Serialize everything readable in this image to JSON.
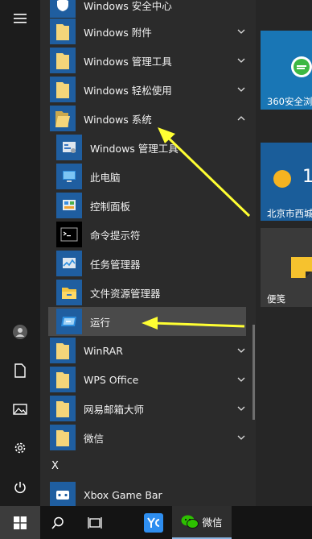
{
  "rail": {
    "items": [
      {
        "name": "hamburger-menu-icon"
      },
      {
        "name": "user-icon"
      },
      {
        "name": "document-icon"
      },
      {
        "name": "pictures-icon"
      },
      {
        "name": "settings-icon"
      },
      {
        "name": "power-icon"
      }
    ]
  },
  "app_list": {
    "top_partial": "Windows 安全中心",
    "folders_top": [
      {
        "label": "Windows 附件",
        "state": "collapsed"
      },
      {
        "label": "Windows 管理工具",
        "state": "collapsed"
      },
      {
        "label": "Windows 轻松使用",
        "state": "collapsed"
      },
      {
        "label": "Windows 系统",
        "state": "expanded"
      }
    ],
    "system_items": [
      {
        "label": "Windows 管理工具",
        "icon": "admin-tools-icon"
      },
      {
        "label": "此电脑",
        "icon": "this-pc-icon"
      },
      {
        "label": "控制面板",
        "icon": "control-panel-icon"
      },
      {
        "label": "命令提示符",
        "icon": "command-prompt-icon"
      },
      {
        "label": "任务管理器",
        "icon": "task-manager-icon"
      },
      {
        "label": "文件资源管理器",
        "icon": "file-explorer-icon"
      },
      {
        "label": "运行",
        "icon": "run-icon",
        "selected": true
      }
    ],
    "folders_bottom": [
      {
        "label": "WinRAR",
        "state": "collapsed"
      },
      {
        "label": "WPS Office",
        "state": "collapsed"
      },
      {
        "label": "网易邮箱大师",
        "state": "collapsed"
      },
      {
        "label": "微信",
        "state": "collapsed"
      }
    ],
    "section_letter": "X",
    "xbox_item": {
      "label": "Xbox Game Bar",
      "icon": "xbox-icon"
    }
  },
  "tiles": {
    "security": {
      "label": "360安全浏"
    },
    "weather": {
      "temp": "1",
      "label": "北京市西城"
    },
    "sticky_notes": {
      "label": "便笺"
    }
  },
  "taskbar": {
    "wechat_label": "微信"
  },
  "colors": {
    "folder_blue": "#1f5ea0",
    "folder_yellow": "#f4d57a",
    "annotation_arrow": "#ffff33"
  }
}
